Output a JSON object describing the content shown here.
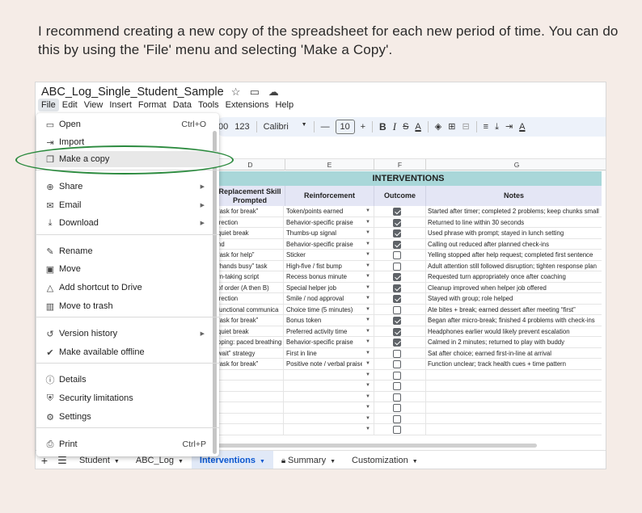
{
  "instruction": "I recommend creating a new copy of the spreadsheet for each new period of time. You can do this by using the 'File' menu and selecting 'Make a Copy'.",
  "doc": {
    "title": "ABC_Log_Single_Student_Sample",
    "title_icons": [
      "star-icon",
      "folder-move-icon",
      "cloud-status-icon"
    ]
  },
  "menubar": [
    "File",
    "Edit",
    "View",
    "Insert",
    "Format",
    "Data",
    "Tools",
    "Extensions",
    "Help"
  ],
  "toolbar": {
    "decimals": "00",
    "number_format": "123",
    "font": "Calibri",
    "font_size": "10",
    "minus": "—",
    "plus": "+",
    "bold": "B",
    "italic": "I",
    "strike": "S",
    "text_color": "A",
    "text_color2": "A"
  },
  "columns": [
    "D",
    "E",
    "F",
    "G"
  ],
  "sheet": {
    "band_title": "INTERVENTIONS",
    "headers": {
      "d": "Replacement Skill Prompted",
      "e": "Reinforcement",
      "f": "Outcome",
      "g": "Notes"
    },
    "rows": [
      {
        "d": "“ask for break”",
        "e": "Token/points earned",
        "f": true,
        "g": "Started after timer; completed 2 problems; keep chunks small"
      },
      {
        "d": "irection",
        "e": "Behavior-specific praise",
        "f": true,
        "g": "Returned to line within 30 seconds"
      },
      {
        "d": "quiet break",
        "e": "Thumbs-up signal",
        "f": true,
        "g": "Used phrase with prompt; stayed in lunch setting"
      },
      {
        "d": "nd",
        "e": "Behavior-specific praise",
        "f": true,
        "g": "Calling out reduced after planned check-ins"
      },
      {
        "d": "“ask for help”",
        "e": "Sticker",
        "f": false,
        "g": "Yelling stopped after help request; completed first sentence"
      },
      {
        "d": "“hands busy” task",
        "e": "High-five / fist bump",
        "f": false,
        "g": "Adult attention still followed disruption; tighten response plan"
      },
      {
        "d": "rn-taking script",
        "e": "Recess bonus minute",
        "f": true,
        "g": "Requested turn appropriately once after coaching"
      },
      {
        "d": "of order (A then B)",
        "e": "Special helper job",
        "f": true,
        "g": "Cleanup improved when helper job offered"
      },
      {
        "d": "irection",
        "e": "Smile / nod approval",
        "f": true,
        "g": "Stayed with group; role helped"
      },
      {
        "d": "functional communica",
        "e": "Choice time (5 minutes)",
        "f": false,
        "g": "Ate bites + break; earned dessert after meeting “first”"
      },
      {
        "d": "“ask for break”",
        "e": "Bonus token",
        "f": true,
        "g": "Began after micro-break; finished 4 problems with check-ins"
      },
      {
        "d": "quiet break",
        "e": "Preferred activity time",
        "f": true,
        "g": "Headphones earlier would likely prevent escalation"
      },
      {
        "d": "oping: paced breathing",
        "e": "Behavior-specific praise",
        "f": true,
        "g": "Calmed in 2 minutes; returned to play with buddy"
      },
      {
        "d": "wait” strategy",
        "e": "First in line",
        "f": false,
        "g": "Sat after choice; earned first-in-line at arrival"
      },
      {
        "d": "“ask for break”",
        "e": "Positive note / verbal praise",
        "f": false,
        "g": "Function unclear; track health cues + time pattern"
      },
      {
        "d": "",
        "e": "",
        "f": false,
        "g": ""
      },
      {
        "d": "",
        "e": "",
        "f": false,
        "g": ""
      },
      {
        "d": "",
        "e": "",
        "f": false,
        "g": ""
      },
      {
        "d": "",
        "e": "",
        "f": false,
        "g": ""
      },
      {
        "d": "",
        "e": "",
        "f": false,
        "g": ""
      },
      {
        "d": "",
        "e": "",
        "f": false,
        "g": ""
      }
    ]
  },
  "file_menu": {
    "items": [
      {
        "icon": "folder-open-icon",
        "glyph": "▭",
        "label": "Open",
        "shortcut": "Ctrl+O"
      },
      {
        "icon": "import-icon",
        "glyph": "⇥",
        "label": "Import"
      },
      {
        "icon": "copy-icon",
        "glyph": "❐",
        "label": "Make a copy",
        "highlighted": true
      },
      {
        "icon": "share-icon",
        "glyph": "⊕",
        "label": "Share",
        "submenu": true
      },
      {
        "icon": "email-icon",
        "glyph": "✉",
        "label": "Email",
        "submenu": true
      },
      {
        "icon": "download-icon",
        "glyph": "⤓",
        "label": "Download",
        "submenu": true
      },
      {
        "icon": "rename-icon",
        "glyph": "✎",
        "label": "Rename"
      },
      {
        "icon": "move-icon",
        "glyph": "▣",
        "label": "Move"
      },
      {
        "icon": "add-shortcut-icon",
        "glyph": "△",
        "label": "Add shortcut to Drive"
      },
      {
        "icon": "trash-icon",
        "glyph": "▥",
        "label": "Move to trash"
      },
      {
        "icon": "history-icon",
        "glyph": "↺",
        "label": "Version history",
        "submenu": true
      },
      {
        "icon": "offline-icon",
        "glyph": "✔",
        "label": "Make available offline"
      },
      {
        "icon": "info-icon",
        "glyph": "ⓘ",
        "label": "Details"
      },
      {
        "icon": "security-icon",
        "glyph": "⛨",
        "label": "Security limitations"
      },
      {
        "icon": "gear-icon",
        "glyph": "⚙",
        "label": "Settings"
      },
      {
        "icon": "print-icon",
        "glyph": "⎙",
        "label": "Print",
        "shortcut": "Ctrl+P"
      }
    ]
  },
  "tabs": [
    {
      "label": "Student",
      "active": false
    },
    {
      "label": "ABC_Log",
      "active": false
    },
    {
      "label": "Interventions",
      "active": true
    },
    {
      "label": "Summary",
      "active": false,
      "locked": true
    },
    {
      "label": "Customization",
      "active": false
    }
  ],
  "colors": {
    "accent": "#0b57d0",
    "band": "#a9d7d9",
    "subheader": "#e4e6f5",
    "highlight_oval": "#2b8a3e",
    "background": "#f5ece7"
  }
}
